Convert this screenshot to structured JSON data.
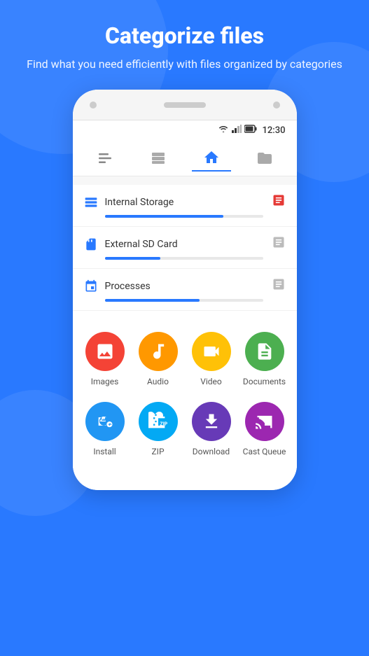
{
  "header": {
    "title": "Categorize files",
    "subtitle": "Find what you need efficiently with files organized by categories"
  },
  "status_bar": {
    "time": "12:30"
  },
  "nav_items": [
    {
      "id": "menu",
      "label": "Menu",
      "active": false
    },
    {
      "id": "storage",
      "label": "Storage",
      "active": false
    },
    {
      "id": "home",
      "label": "Home",
      "active": true
    },
    {
      "id": "folder",
      "label": "Folder",
      "active": false
    }
  ],
  "storage_items": [
    {
      "id": "internal",
      "label": "Internal Storage",
      "fill_pct": 75,
      "icon": "internal"
    },
    {
      "id": "sdcard",
      "label": "External SD Card",
      "fill_pct": 35,
      "icon": "sdcard"
    },
    {
      "id": "processes",
      "label": "Processes",
      "fill_pct": 60,
      "icon": "processes"
    }
  ],
  "categories": [
    {
      "id": "images",
      "label": "Images",
      "icon": "images",
      "color": "icon-images"
    },
    {
      "id": "audio",
      "label": "Audio",
      "icon": "audio",
      "color": "icon-audio"
    },
    {
      "id": "video",
      "label": "Video",
      "icon": "video",
      "color": "icon-video"
    },
    {
      "id": "documents",
      "label": "Documents",
      "icon": "docs",
      "color": "icon-docs"
    },
    {
      "id": "install",
      "label": "Install",
      "icon": "install",
      "color": "icon-install"
    },
    {
      "id": "zip",
      "label": "ZIP",
      "icon": "zip",
      "color": "icon-zip"
    },
    {
      "id": "download",
      "label": "Download",
      "icon": "download",
      "color": "icon-download"
    },
    {
      "id": "cast-queue",
      "label": "Cast Queue",
      "icon": "cast",
      "color": "icon-cast"
    }
  ]
}
